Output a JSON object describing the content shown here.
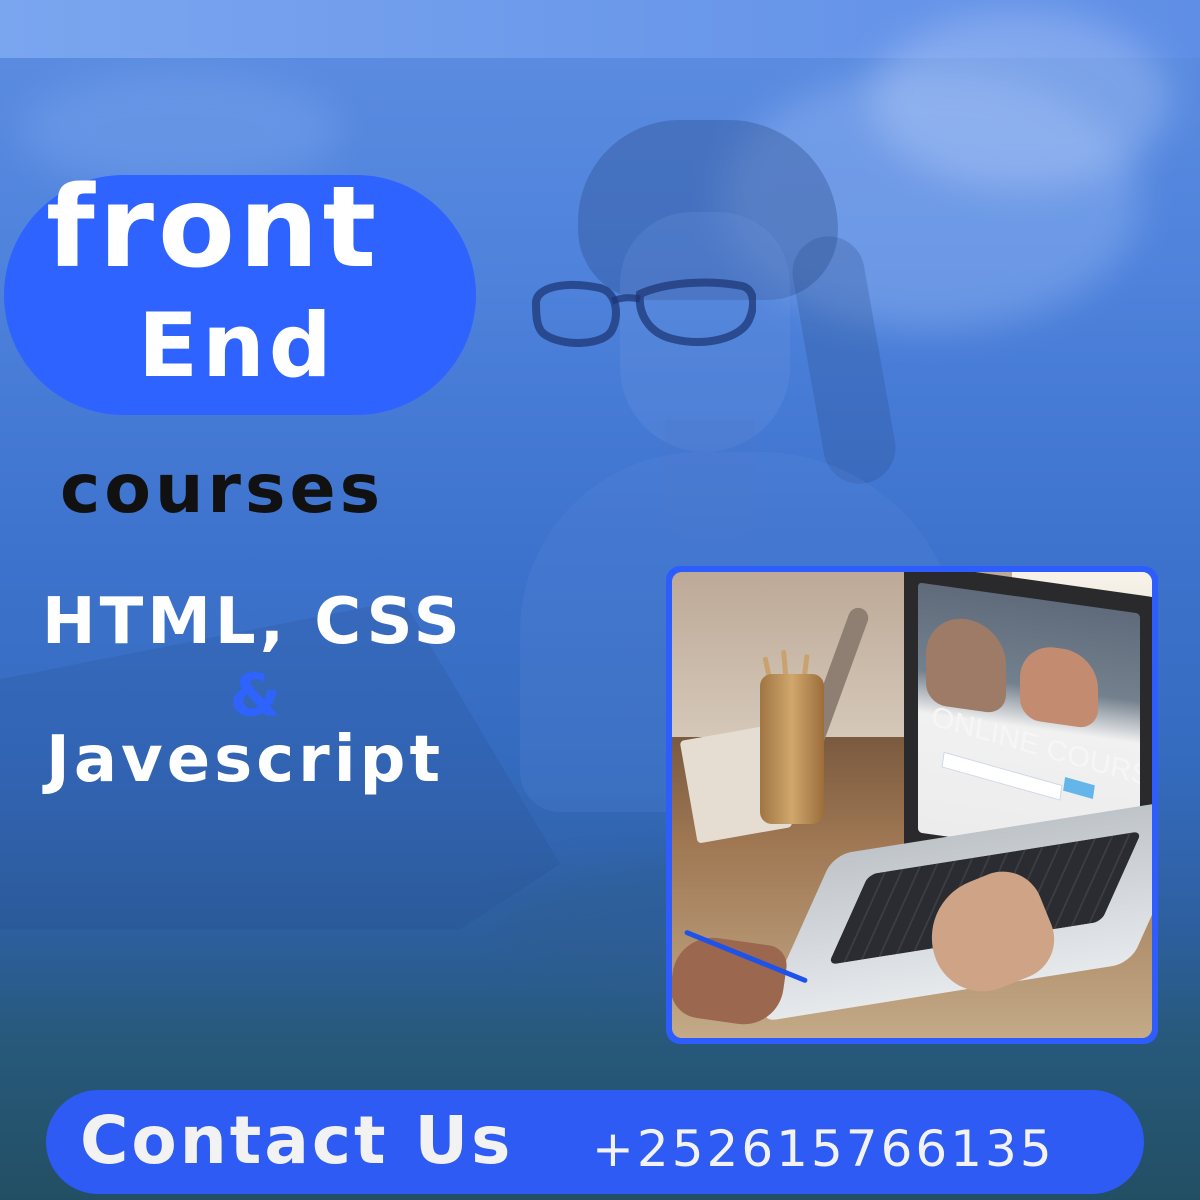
{
  "poster": {
    "title_line_1": "front",
    "title_line_2": "End",
    "subtitle": "courses",
    "skills_line_1": "HTML, CSS",
    "skills_ampersand": "&",
    "skills_line_2": "Javescript",
    "inset_screen_text": "ONLINE COURSE",
    "contact_label": "Contact Us",
    "contact_phone": "+252615766135"
  },
  "colors": {
    "background_blue": "#3f78d6",
    "accent_blue": "#2f63ff",
    "contact_blue": "#2d5bf3",
    "text_white": "#ffffff",
    "text_black": "#111111"
  },
  "icons": {
    "decorative_photo": "laptop-photo"
  }
}
